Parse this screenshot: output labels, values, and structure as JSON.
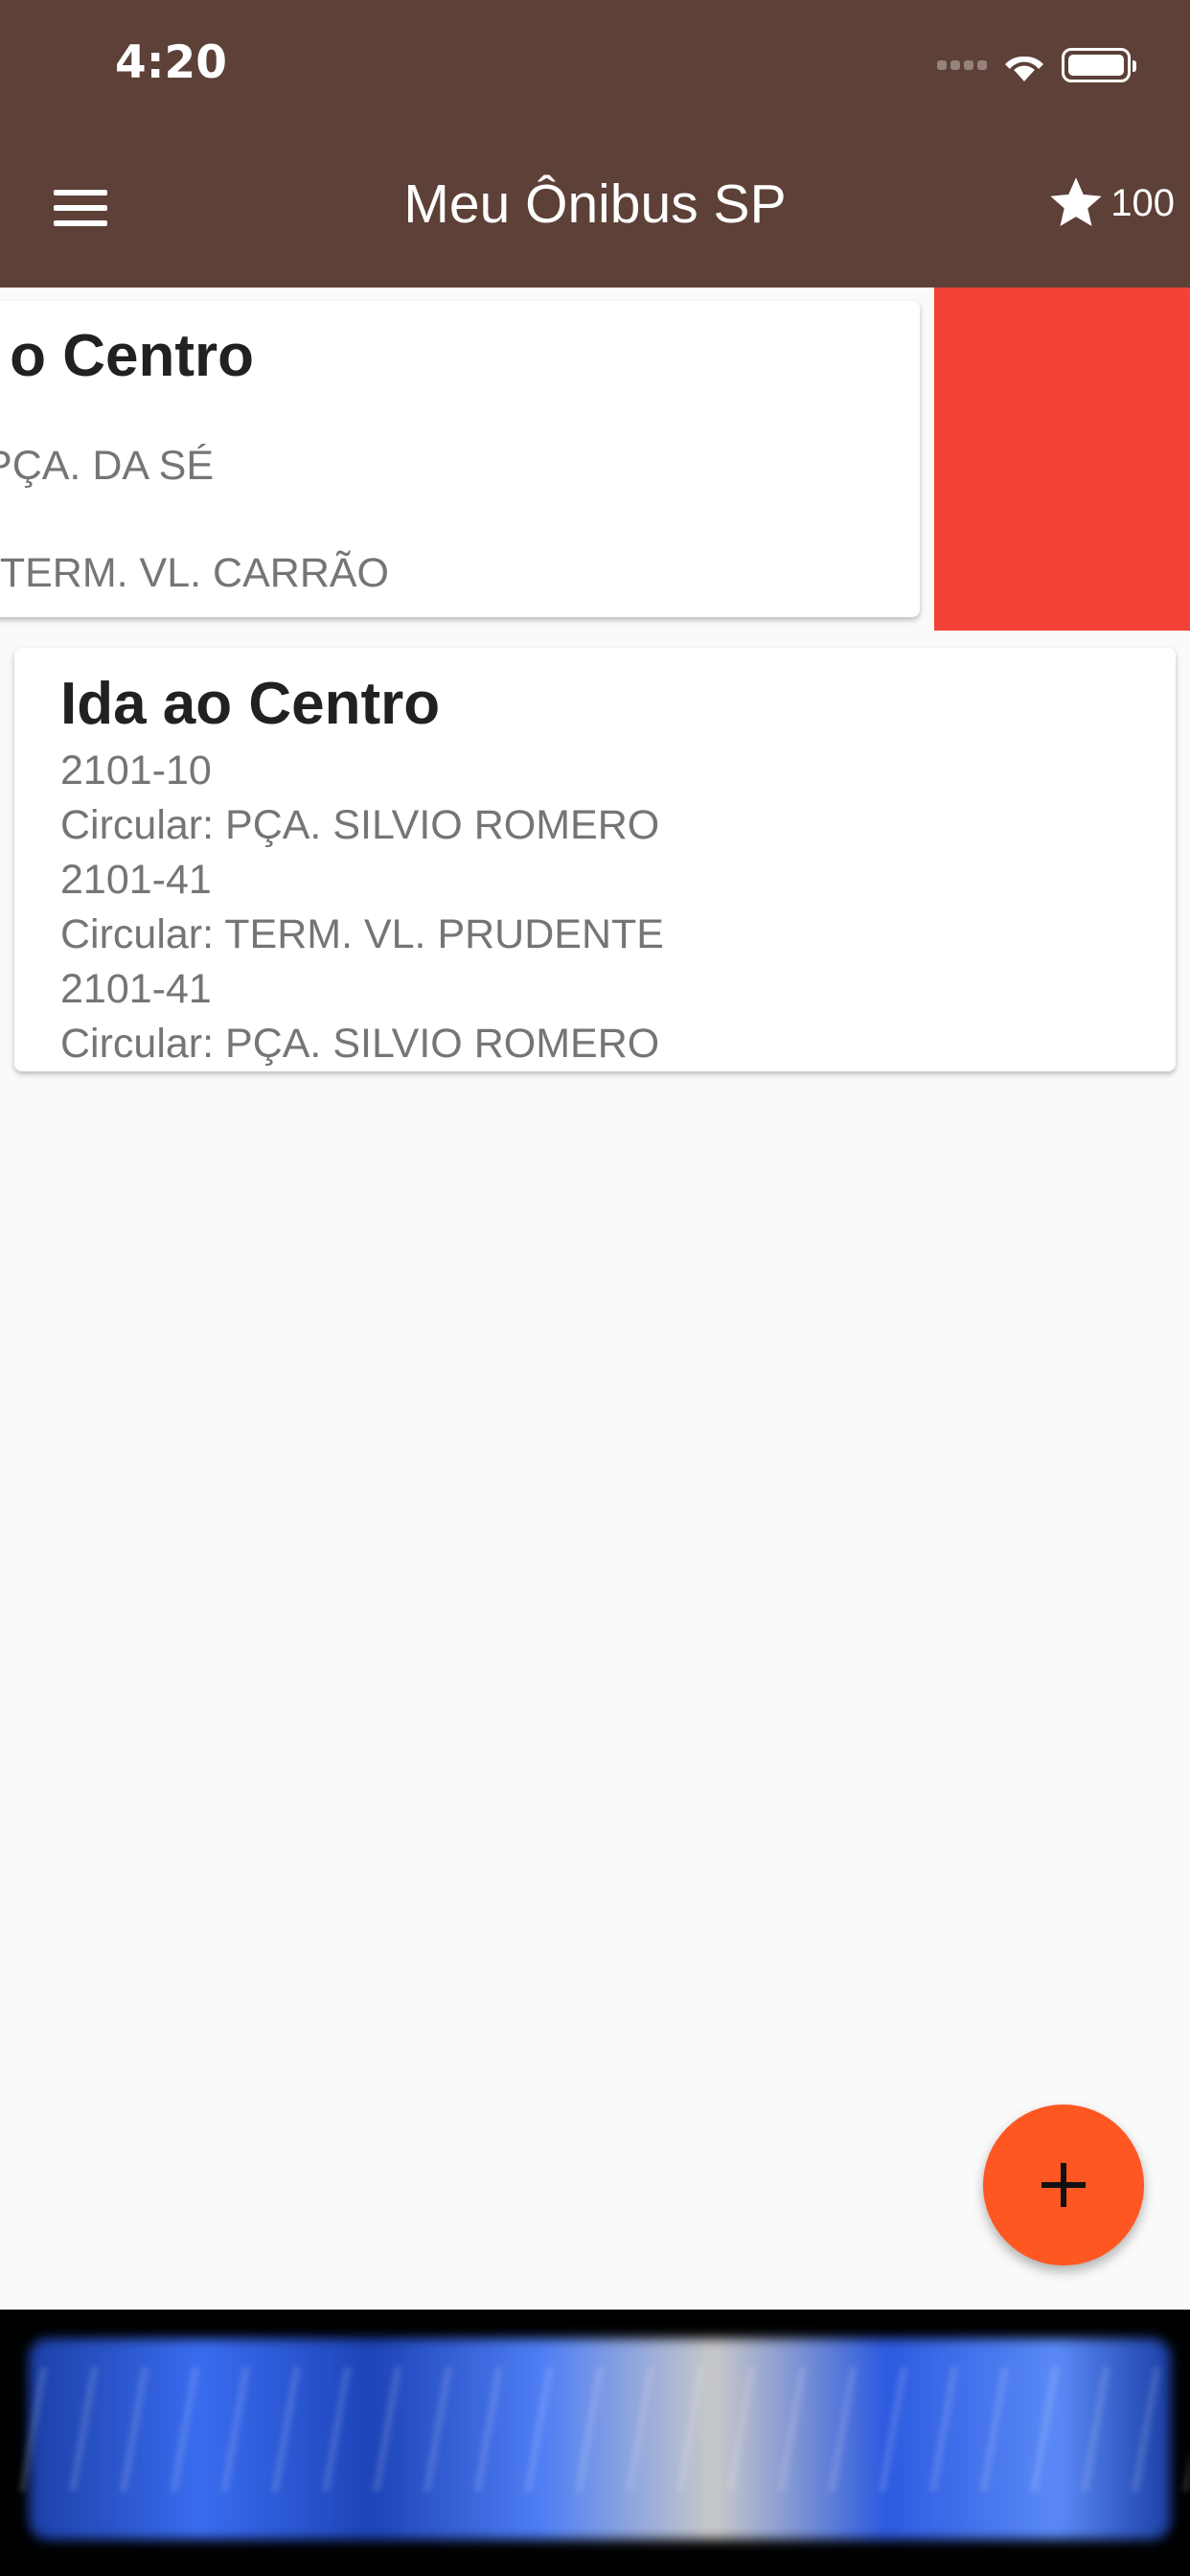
{
  "status_bar": {
    "time": "4:20"
  },
  "app_bar": {
    "title": "Meu Ônibus SP",
    "points": "100"
  },
  "cards": [
    {
      "title": "o Centro",
      "lines": [
        "PÇA. DA SÉ",
        "TERM. VL. CARRÃO"
      ]
    },
    {
      "title": "Ida ao Centro",
      "lines": [
        "2101-10",
        "Circular: PÇA. SILVIO ROMERO",
        "2101-41",
        "Circular: TERM. VL. PRUDENTE",
        "2101-41",
        "Circular: PÇA. SILVIO ROMERO"
      ]
    }
  ],
  "colors": {
    "app_bar": "#5d4037",
    "delete_swipe": "#f44336",
    "fab": "#ff5722",
    "background": "#fafafa"
  },
  "icons": {
    "menu": "menu-icon",
    "points": "star-icon",
    "fab": "plus-icon"
  }
}
